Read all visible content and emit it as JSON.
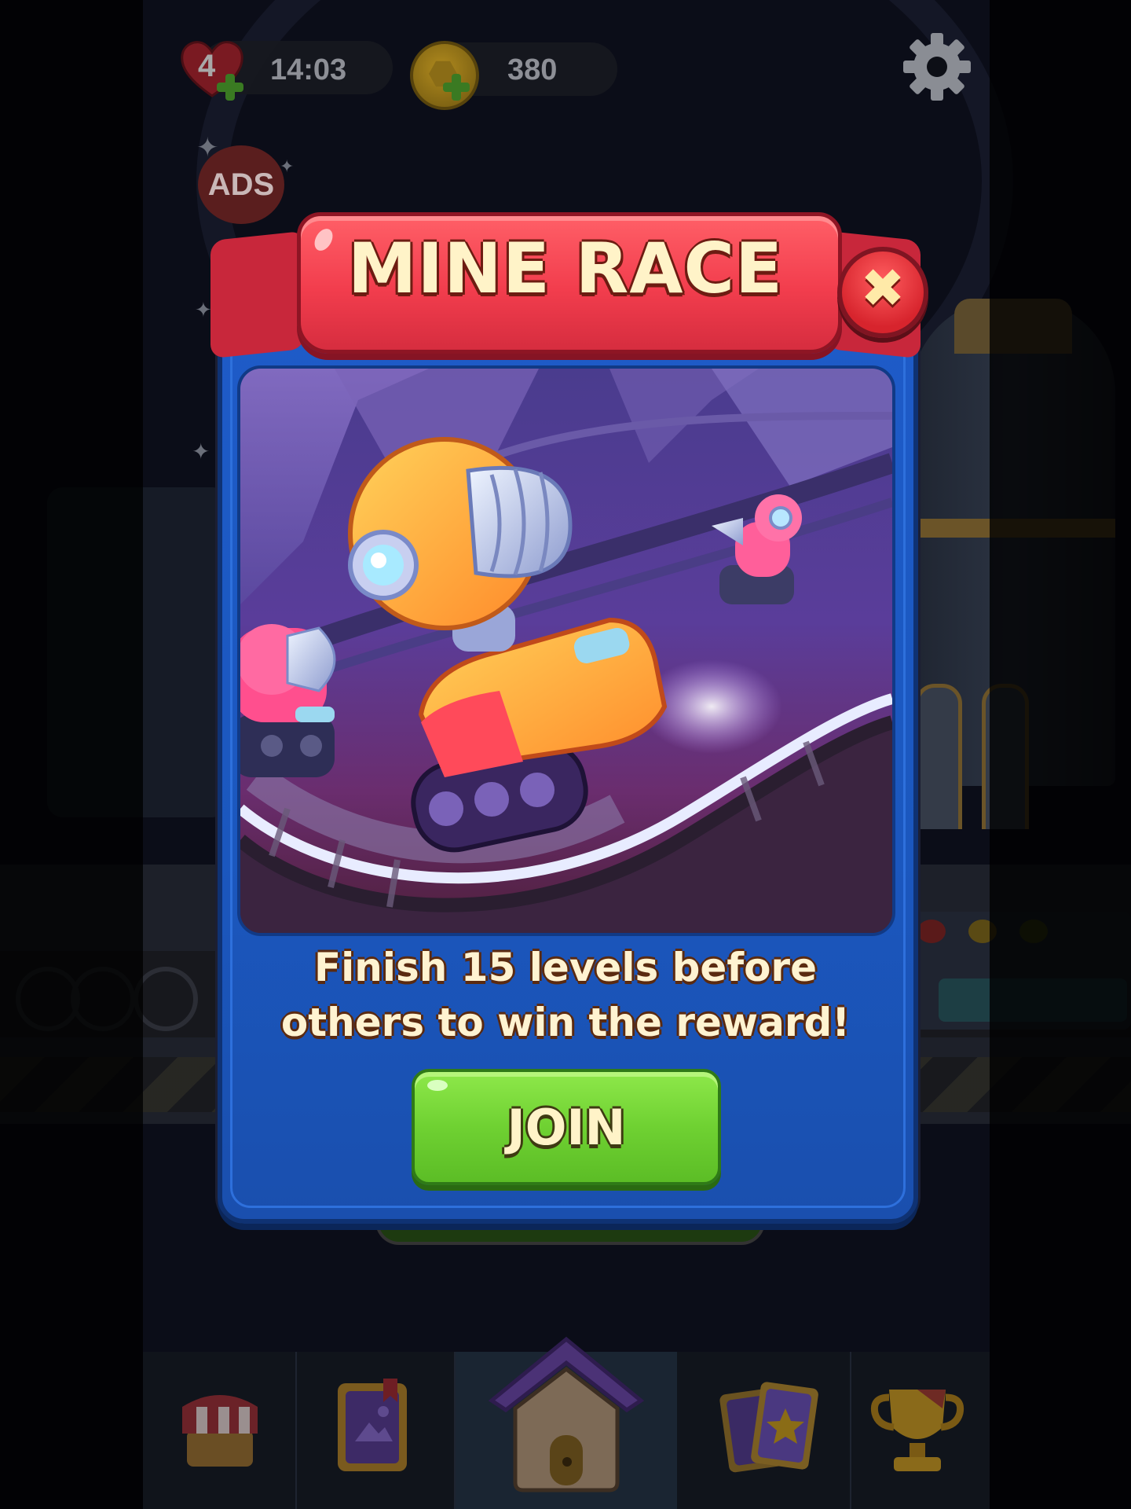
{
  "hud": {
    "lives": "4",
    "lives_timer": "14:03",
    "coins": "380",
    "ads_badge": "ADS"
  },
  "dialog": {
    "title": "MINE RACE",
    "close_symbol": "✖",
    "description_line1": "Finish 15 levels before",
    "description_line2": "others to win the reward!",
    "join_label": "JOIN"
  },
  "icons": {
    "lives": "heart-icon",
    "coins": "coin-icon",
    "settings": "gear-icon",
    "remove_ads": "no-ads-icon",
    "close": "close-icon"
  },
  "nav": {
    "tabs": [
      "shop",
      "album",
      "home",
      "cards",
      "leaderboard"
    ],
    "active": "home"
  },
  "colors": {
    "ribbon": "#f23d4d",
    "dialog_blue": "#1e5bc8",
    "join_green": "#6fd132",
    "title_text": "#fff3c8"
  }
}
